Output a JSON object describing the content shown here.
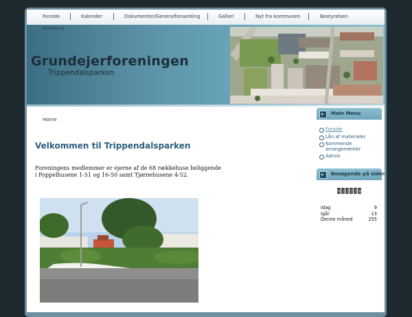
{
  "nav": {
    "items": [
      "Forside",
      "Kalender",
      "Dokumenter/Generalforsamling",
      "Galleri",
      "Nyt fra kommunen",
      "Bestyrelsen"
    ],
    "second_row": "Kontakt os"
  },
  "banner": {
    "title": "Grundejerforeningen",
    "subtitle": "Trippendalsparken"
  },
  "content": {
    "breadcrumb": "Home",
    "heading": "Velkommen til Trippendalsparken",
    "paragraph_line1": "Foreningens medlemmer er ejerne af de 68 rækkehuse beliggende",
    "paragraph_line2": "i Poppelhusene 1-51 og 16-50 samt Tjørnehusene 4-52."
  },
  "sidebar": {
    "main_menu": {
      "heading": "Main Menu",
      "items": [
        "Forside",
        "Lån af materialer",
        "Kommende arrangementer",
        "Admin"
      ]
    },
    "visitors": {
      "heading": "Besøgende på siden",
      "counter_digits": [
        "0",
        "1",
        "2",
        "5",
        "3",
        "8"
      ],
      "rows": [
        {
          "label": "Idag",
          "value": "9"
        },
        {
          "label": "Igår",
          "value": "13"
        },
        {
          "label": "Denne måned",
          "value": "255"
        }
      ]
    }
  },
  "colors": {
    "accent": "#2c5d7c",
    "banner": "#5d93a8",
    "background": "#1f2a30"
  }
}
